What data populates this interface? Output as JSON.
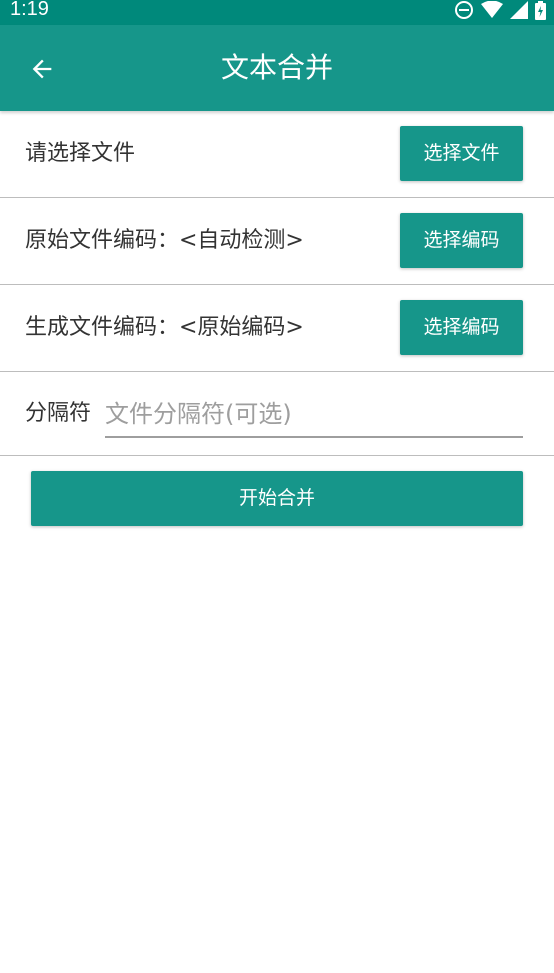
{
  "status_bar": {
    "time": "1:19",
    "icons": [
      "do-not-disturb-icon",
      "wifi-icon",
      "signal-icon",
      "battery-charging-icon"
    ]
  },
  "app_bar": {
    "title": "文本合并",
    "back_icon": "arrow-back-icon",
    "color": "#16968a"
  },
  "file_row": {
    "label": "请选择文件",
    "button": "选择文件"
  },
  "source_encoding_row": {
    "label": "原始文件编码：<自动检测>",
    "button": "选择编码"
  },
  "output_encoding_row": {
    "label": "生成文件编码：<原始编码>",
    "button": "选择编码"
  },
  "separator_row": {
    "label": "分隔符",
    "value": "",
    "placeholder": "文件分隔符(可选)"
  },
  "start_button": "开始合并"
}
